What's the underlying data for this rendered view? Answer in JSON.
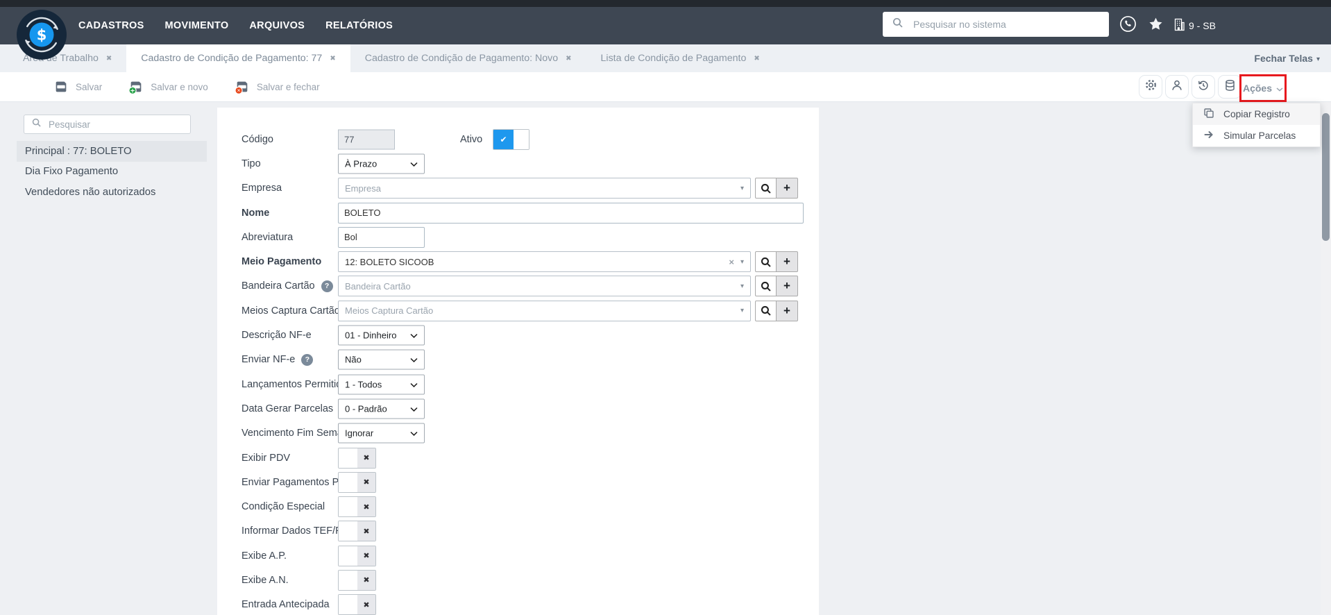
{
  "navbar": {
    "menu": [
      "CADASTROS",
      "MOVIMENTO",
      "ARQUIVOS",
      "RELATÓRIOS"
    ],
    "search_placeholder": "Pesquisar no sistema",
    "company": "9 - SB"
  },
  "tabs": [
    {
      "label": "Área de Trabalho",
      "active": false
    },
    {
      "label": "Cadastro de Condição de Pagamento: 77",
      "active": true
    },
    {
      "label": "Cadastro de Condição de Pagamento: Novo",
      "active": false
    },
    {
      "label": "Lista de Condição de Pagamento",
      "active": false
    }
  ],
  "fechar_telas_label": "Fechar Telas",
  "toolbar": {
    "buttons": [
      {
        "label": "Salvar",
        "icon": "save-icon"
      },
      {
        "label": "Salvar e novo",
        "icon": "save-new-icon"
      },
      {
        "label": "Salvar e fechar",
        "icon": "save-close-icon"
      }
    ],
    "icon_buttons": [
      "settings-icon",
      "user-icon",
      "history-icon",
      "database-icon"
    ],
    "acoes_label": "Ações"
  },
  "acoes_menu": [
    {
      "label": "Copiar Registro",
      "icon": "copy-icon"
    },
    {
      "label": "Simular Parcelas",
      "icon": "arrow-right-icon"
    }
  ],
  "sidebar": {
    "search_placeholder": "Pesquisar",
    "items": [
      {
        "label": "Principal : 77: BOLETO",
        "selected": true
      },
      {
        "label": "Dia Fixo Pagamento",
        "selected": false
      },
      {
        "label": "Vendedores não autorizados",
        "selected": false
      }
    ]
  },
  "form": {
    "ativo": {
      "label": "Ativo",
      "on": true
    },
    "rows": [
      {
        "label": "Código",
        "type": "code",
        "value": "77"
      },
      {
        "label": "Tipo",
        "type": "select",
        "value": "À Prazo"
      },
      {
        "label": "Empresa",
        "type": "combo",
        "placeholder": "Empresa"
      },
      {
        "label": "Nome",
        "bold": true,
        "type": "text",
        "value": "BOLETO",
        "wide": true
      },
      {
        "label": "Abreviatura",
        "type": "text",
        "value": "Bol"
      },
      {
        "label": "Meio Pagamento",
        "bold": true,
        "type": "combo",
        "value": "12: BOLETO SICOOB",
        "clearable": true
      },
      {
        "label": "Bandeira Cartão",
        "help": true,
        "type": "combo",
        "placeholder": "Bandeira Cartão"
      },
      {
        "label": "Meios Captura Cartão",
        "help": true,
        "type": "combo",
        "placeholder": "Meios Captura Cartão"
      },
      {
        "label": "Descrição NF-e",
        "type": "select",
        "value": "01 - Dinheiro"
      },
      {
        "label": "Enviar NF-e",
        "help": true,
        "type": "select",
        "value": "Não"
      },
      {
        "label": "Lançamentos Permitidos",
        "type": "select",
        "value": "1 - Todos"
      },
      {
        "label": "Data Gerar Parcelas",
        "type": "select",
        "value": "0 - Padrão"
      },
      {
        "label": "Vencimento Fim Semana",
        "type": "select",
        "value": "Ignorar"
      },
      {
        "label": "Exibir PDV",
        "type": "toggle",
        "on": false
      },
      {
        "label": "Enviar Pagamentos PDV",
        "type": "toggle",
        "on": false
      },
      {
        "label": "Condição Especial",
        "type": "toggle",
        "on": false
      },
      {
        "label": "Informar Dados TEF/POS",
        "help": true,
        "type": "toggle",
        "on": false
      },
      {
        "label": "Exibe A.P.",
        "type": "toggle",
        "on": false
      },
      {
        "label": "Exibe A.N.",
        "type": "toggle",
        "on": false
      },
      {
        "label": "Entrada Antecipada",
        "type": "toggle",
        "on": false
      }
    ]
  },
  "icons": {
    "close": "✖",
    "check": "✔",
    "cross": "✖",
    "plus": "+",
    "question": "?",
    "caret_down": "▾",
    "clear": "×"
  },
  "colors": {
    "accent_blue": "#1e98ee",
    "annotation_red": "#e7191e",
    "navbar": "#3e4753"
  }
}
